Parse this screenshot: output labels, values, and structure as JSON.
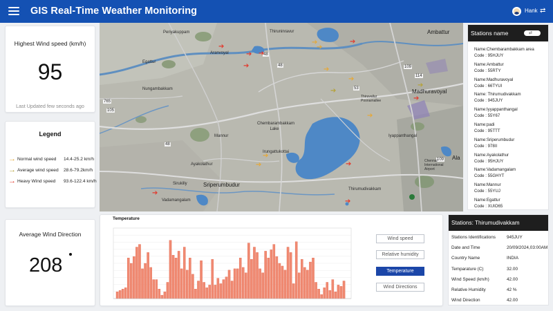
{
  "header": {
    "title": "GIS Real-Time Weather Monitoring",
    "user": "Hank"
  },
  "wind_speed": {
    "title": "Highest Wind speed (km/h)",
    "value": "95",
    "updated": "Last Updated few seconds ago"
  },
  "legend": {
    "title": "Legend",
    "items": [
      {
        "name": "Normal wind speed",
        "range": "14.4-25.2 km/h",
        "color": "#e5a83a"
      },
      {
        "name": "Average wind speed",
        "range": "28.6-79.2km/h",
        "color": "#b5a23a"
      },
      {
        "name": "Heavy Wind speed",
        "range": "93.6-122.4 km/h",
        "color": "#e23a2e"
      }
    ]
  },
  "direction": {
    "title": "Average Wind Direction",
    "value": "208"
  },
  "map": {
    "labels": [
      "Periyakuppam",
      "Thiruninravur",
      "Aranvoyal",
      "Ambattur",
      "Egattur",
      "Nungambakkam",
      "Madhuravoyal",
      "Chembarambakkam Lake",
      "Mannur",
      "Iyappanthangal",
      "Irungattukottai",
      "Ayakolathur",
      "Sriperumbudur",
      "Sirukilly",
      "Vadamangalam",
      "Thirumudivakkam",
      "Chennai International Airport",
      "Thiruvallur Poonamallee",
      "Ala"
    ],
    "road_shields": [
      "765",
      "105",
      "48",
      "48",
      "109",
      "114",
      "53",
      "48",
      "109"
    ]
  },
  "stations": {
    "title": "Stations name",
    "toggle_icon": "swap-arrows",
    "items": [
      {
        "name": "Name:Chembarambakkam area",
        "code": "Code : 95HJUY"
      },
      {
        "name": "Name:Ambattur",
        "code": "Code : 55RTY"
      },
      {
        "name": "Name:Madhuravoyal",
        "code": "Code : 66TYUI"
      },
      {
        "name": "Name: Thirumudivakkam",
        "code": "Code : 945JUY"
      },
      {
        "name": "Name:Iyyappanthangal",
        "code": "Code : 55Y67"
      },
      {
        "name": "Name:padi",
        "code": "Code : 95TTT"
      },
      {
        "name": "Name:Sriperumbudur",
        "code": "Code : 978II"
      },
      {
        "name": "Name:Ayakolathur",
        "code": "Code : 95HJUY"
      },
      {
        "name": "Name:Vadamangalam",
        "code": "Code : 55GHYT"
      },
      {
        "name": "Name:Mannur",
        "code": "Code : 55YUJ"
      },
      {
        "name": "Name:Egattur",
        "code": "Code : XUIO65"
      }
    ]
  },
  "chart": {
    "title": "Temperature",
    "colors": {
      "bar": "#f08a72",
      "bar_stroke": "#e46b52"
    }
  },
  "chart_data": {
    "type": "bar",
    "title": "Temperature",
    "values": [
      10,
      12,
      14,
      16,
      60,
      52,
      62,
      76,
      80,
      44,
      52,
      68,
      46,
      28,
      28,
      14,
      5,
      10,
      24,
      86,
      64,
      60,
      70,
      44,
      76,
      42,
      60,
      36,
      14,
      26,
      56,
      24,
      16,
      20,
      58,
      20,
      30,
      22,
      28,
      32,
      42,
      26,
      44,
      44,
      60,
      46,
      38,
      82,
      58,
      76,
      68,
      44,
      38,
      70,
      60,
      72,
      80,
      62,
      52,
      48,
      42,
      76,
      68,
      22,
      84,
      38,
      58,
      46,
      42,
      54,
      60,
      24,
      14,
      6,
      16,
      24,
      12,
      28,
      10,
      20,
      18,
      26
    ],
    "ylim": [
      0,
      100
    ],
    "grid": true
  },
  "tabs": [
    {
      "label": "Wind speed",
      "active": false
    },
    {
      "label": "Relative humidity",
      "active": false
    },
    {
      "label": "Temperature",
      "active": true
    },
    {
      "label": "Wind Directions",
      "active": false
    }
  ],
  "detail": {
    "title": "Stations: Thirumudivakkam",
    "rows": [
      {
        "label": "Stations Identifications",
        "value": "945JUY"
      },
      {
        "label": "Date and Time",
        "value": "20/09/2024,03:00AM"
      },
      {
        "label": "Country Name",
        "value": "INDIA"
      },
      {
        "label": "Temparature (C)",
        "value": "32.00"
      },
      {
        "label": "Wind Speed (km/h)",
        "value": "42.00"
      },
      {
        "label": "Relative Humidity",
        "value": "42 %"
      },
      {
        "label": "Wind Direction",
        "value": "42.00"
      }
    ]
  }
}
